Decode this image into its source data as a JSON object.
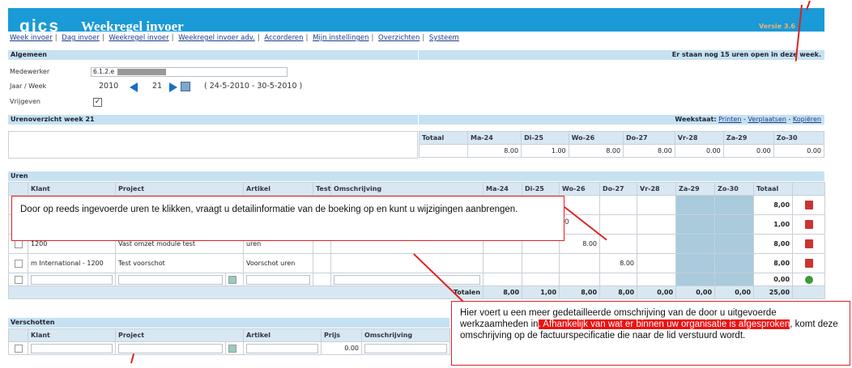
{
  "app": {
    "logo": "qics",
    "title": "Weekregel invoer",
    "version": "Versie 3.6"
  },
  "nav": [
    "Week invoer",
    "Dag invoer",
    "Weekregel invoer",
    "Weekregel invoer adv.",
    "Accorderen",
    "Mijn instellingen",
    "Overzichten",
    "Systeem"
  ],
  "algemeen": {
    "title": "Algemeen",
    "status": "Er staan nog 15 uren open in deze week.",
    "medewerker_label": "Medewerker",
    "medewerker_value": "6.1.2.e",
    "jaarweek_label": "Jaar / Week",
    "jaar": "2010",
    "week": "21",
    "range": "( 24-5-2010 - 30-5-2010 )",
    "vrijgeven_label": "Vrijgeven",
    "vrijgeven_check": "✓"
  },
  "overzicht": {
    "title": "Urenoverzicht week 21",
    "weekstaat": "Weekstaat:",
    "printen": "Printen",
    "verplaatsen": "Verplaatsen",
    "kopieren": "Kopiëren",
    "dash": "-",
    "totaal_label": "Totaal",
    "days": [
      "Ma-24",
      "Di-25",
      "Wo-26",
      "Do-27",
      "Vr-28",
      "Za-29",
      "Zo-30"
    ],
    "values": [
      "8.00",
      "1.00",
      "8.00",
      "8.00",
      "0.00",
      "0.00",
      "0.00"
    ]
  },
  "uren": {
    "title": "Uren",
    "headers": [
      "Klant",
      "Project",
      "Artikel",
      "Test",
      "Omschrijving",
      "Ma-24",
      "Di-25",
      "Wo-26",
      "Do-27",
      "Vr-28",
      "Za-29",
      "Zo-30",
      "Totaal"
    ],
    "rows": [
      {
        "klant": "",
        "project": "",
        "artikel": "",
        "omschr": "",
        "cells": [
          "",
          "",
          "",
          "",
          "",
          "",
          ""
        ],
        "total": "8,00"
      },
      {
        "klant": "",
        "project": "",
        "artikel": "",
        "omschr": "",
        "cells": [
          "",
          "",
          "",
          "",
          "",
          "",
          ""
        ],
        "total": "1,00"
      },
      {
        "klant": "1200",
        "project": "Vast omzet module test",
        "artikel": "uren",
        "omschr": "",
        "cells": [
          "",
          "",
          "8.00",
          "",
          "",
          "",
          ""
        ],
        "total": "8,00"
      },
      {
        "klant": "m International - 1200",
        "project": "Test voorschot",
        "artikel": "Voorschot uren",
        "omschr": "",
        "cells": [
          "",
          "",
          "",
          "8.00",
          "",
          "",
          ""
        ],
        "total": "8,00"
      },
      {
        "klant": "",
        "project": "",
        "artikel": "",
        "omschr": "",
        "cells": [
          "",
          "",
          "",
          "",
          "",
          "",
          ""
        ],
        "total": "0,00"
      }
    ],
    "totalen_label": "Totalen",
    "totalen": [
      "8,00",
      "1,00",
      "8,00",
      "8,00",
      "0,00",
      "0,00",
      "0,00",
      "25,00"
    ]
  },
  "verschotten": {
    "title": "Verschotten",
    "headers": [
      "Klant",
      "Project",
      "Artikel",
      "Prijs",
      "Omschrijving"
    ],
    "prijs": "0.00"
  },
  "callout1": "Door op reeds ingevoerde uren te klikken, vraagt u detailinformatie van de boeking op en  kunt u wijzigingen aanbrengen.",
  "callout2": {
    "pre": "Hier voert u een meer gedetailleerde omschrijving van de door u uitgevoerde werkzaamheden in",
    "hl": ". Afhankelijk van wat er binnen uw organisatie is afgesproken",
    "post": ", komt deze omschrijving op de factuurspecificatie die naar de lid verstuurd wordt."
  },
  "row_fragment": "0"
}
